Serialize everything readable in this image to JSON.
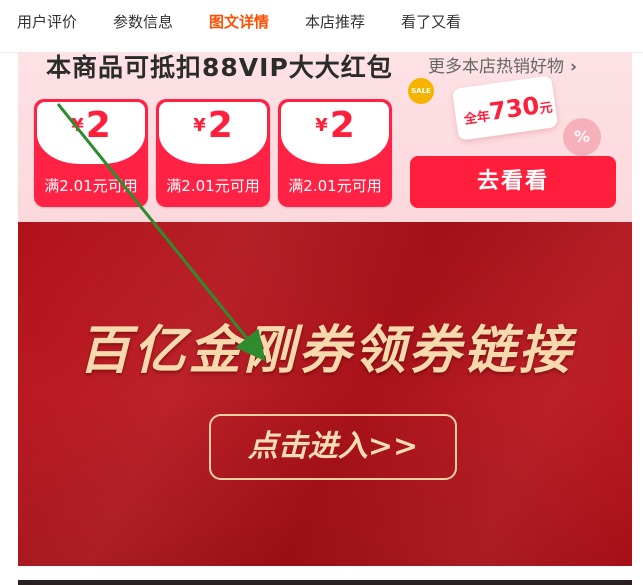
{
  "tabs": [
    {
      "label": "用户评价",
      "active": false
    },
    {
      "label": "参数信息",
      "active": false
    },
    {
      "label": "图文详情",
      "active": true
    },
    {
      "label": "本店推荐",
      "active": false
    },
    {
      "label": "看了又看",
      "active": false
    }
  ],
  "coupon_banner": {
    "title": "本商品可抵扣88VIP大大红包",
    "more_link": "更多本店热销好物",
    "coupons": [
      {
        "currency": "¥",
        "value": "2",
        "condition": "满2.01元可用"
      },
      {
        "currency": "¥",
        "value": "2",
        "condition": "满2.01元可用"
      },
      {
        "currency": "¥",
        "value": "2",
        "condition": "满2.01元可用"
      }
    ],
    "sale_badge": "SALE",
    "vip_card_prefix": "全年",
    "vip_card_amount": "730",
    "vip_card_unit": "元",
    "percent_badge": "%",
    "go_button": "去看看"
  },
  "promo_banner": {
    "headline": "百亿金刚券领券链接",
    "enter_button": "点击进入>>"
  },
  "colors": {
    "accent": "#ff5000",
    "coupon_red": "#ff1e3c",
    "banner_red": "#b1121a",
    "gold_text": "#f7d9ae",
    "annotation_arrow": "#2e8b2e"
  }
}
